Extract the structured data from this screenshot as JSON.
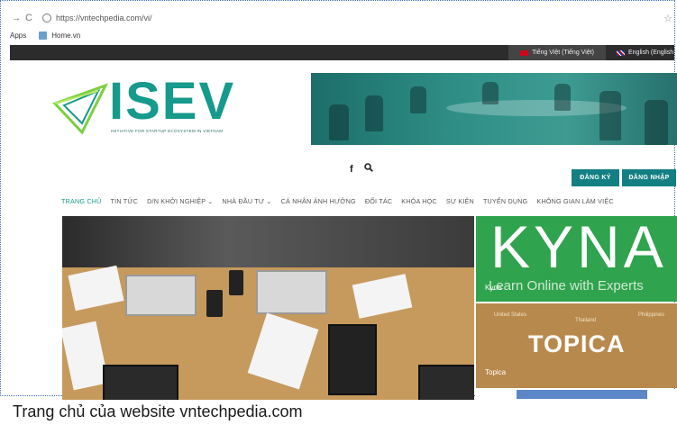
{
  "browser": {
    "back_icon": "arrow-left-icon",
    "reload_icon": "reload-icon",
    "url": "https://vntechpedia.com/vi/",
    "apps_label": "Apps",
    "bookmark_label": "Home.vn"
  },
  "langbar": {
    "vietnamese": "Tiếng Việt (Tiếng Việt)",
    "english": "English (English"
  },
  "logo": {
    "text": "ISEV",
    "subtitle": "INITIATIVE FOR STARTUP ECOSYSTEM IN VIETNAM"
  },
  "header": {
    "facebook": "f",
    "search_icon": "search-icon",
    "register": "ĐĂNG KÝ",
    "login": "ĐĂNG NHẬP"
  },
  "menu": [
    "TRANG CHỦ",
    "TIN TỨC",
    "D/N KHỞI NGHIỆP ⌄",
    "NHÀ ĐẦU TƯ ⌄",
    "CÁ NHÂN ẢNH HƯỞNG",
    "ĐỐI TÁC",
    "KHÓA HỌC",
    "SỰ KIỆN",
    "TUYỂN DỤNG",
    "KHÔNG GIAN LÀM VIỆC"
  ],
  "side": {
    "kyna_big": "KYNA",
    "kyna_tag": "Learn Online with Experts",
    "kyna_caption": "Kyna",
    "topica_logo": "TOPICA",
    "topica_caption": "Topica",
    "pins": [
      "United States",
      "Thailand",
      "Philippines"
    ]
  },
  "caption": "Trang chủ của website vntechpedia.com",
  "colors": {
    "accent": "#159a8c",
    "button": "#137f83",
    "kyna": "#2fa34d",
    "topica": "#b8894d"
  }
}
